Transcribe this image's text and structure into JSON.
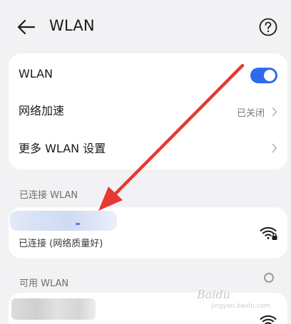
{
  "header": {
    "title": "WLAN",
    "back_icon": "arrow-left-icon",
    "help_icon": "question-circle-icon"
  },
  "settings": {
    "wlan_label": "WLAN",
    "wlan_enabled": true,
    "network_accel_label": "网络加速",
    "network_accel_value": "已关闭",
    "more_settings_label": "更多 WLAN 设置"
  },
  "connected_section": {
    "header": "已连接 WLAN",
    "network": {
      "status": "已连接 (网络质量好)",
      "signal_icon": "wifi-locked-icon"
    }
  },
  "available_section": {
    "header": "可用 WLAN",
    "scanning_icon": "loading-circle-icon"
  },
  "watermark": {
    "brand": "Baidu",
    "url": "jingyan.baidu.com"
  },
  "colors": {
    "accent": "#2f6bf0",
    "annotation": "#e53935",
    "background": "#f2f2f4",
    "card": "#ffffff"
  }
}
